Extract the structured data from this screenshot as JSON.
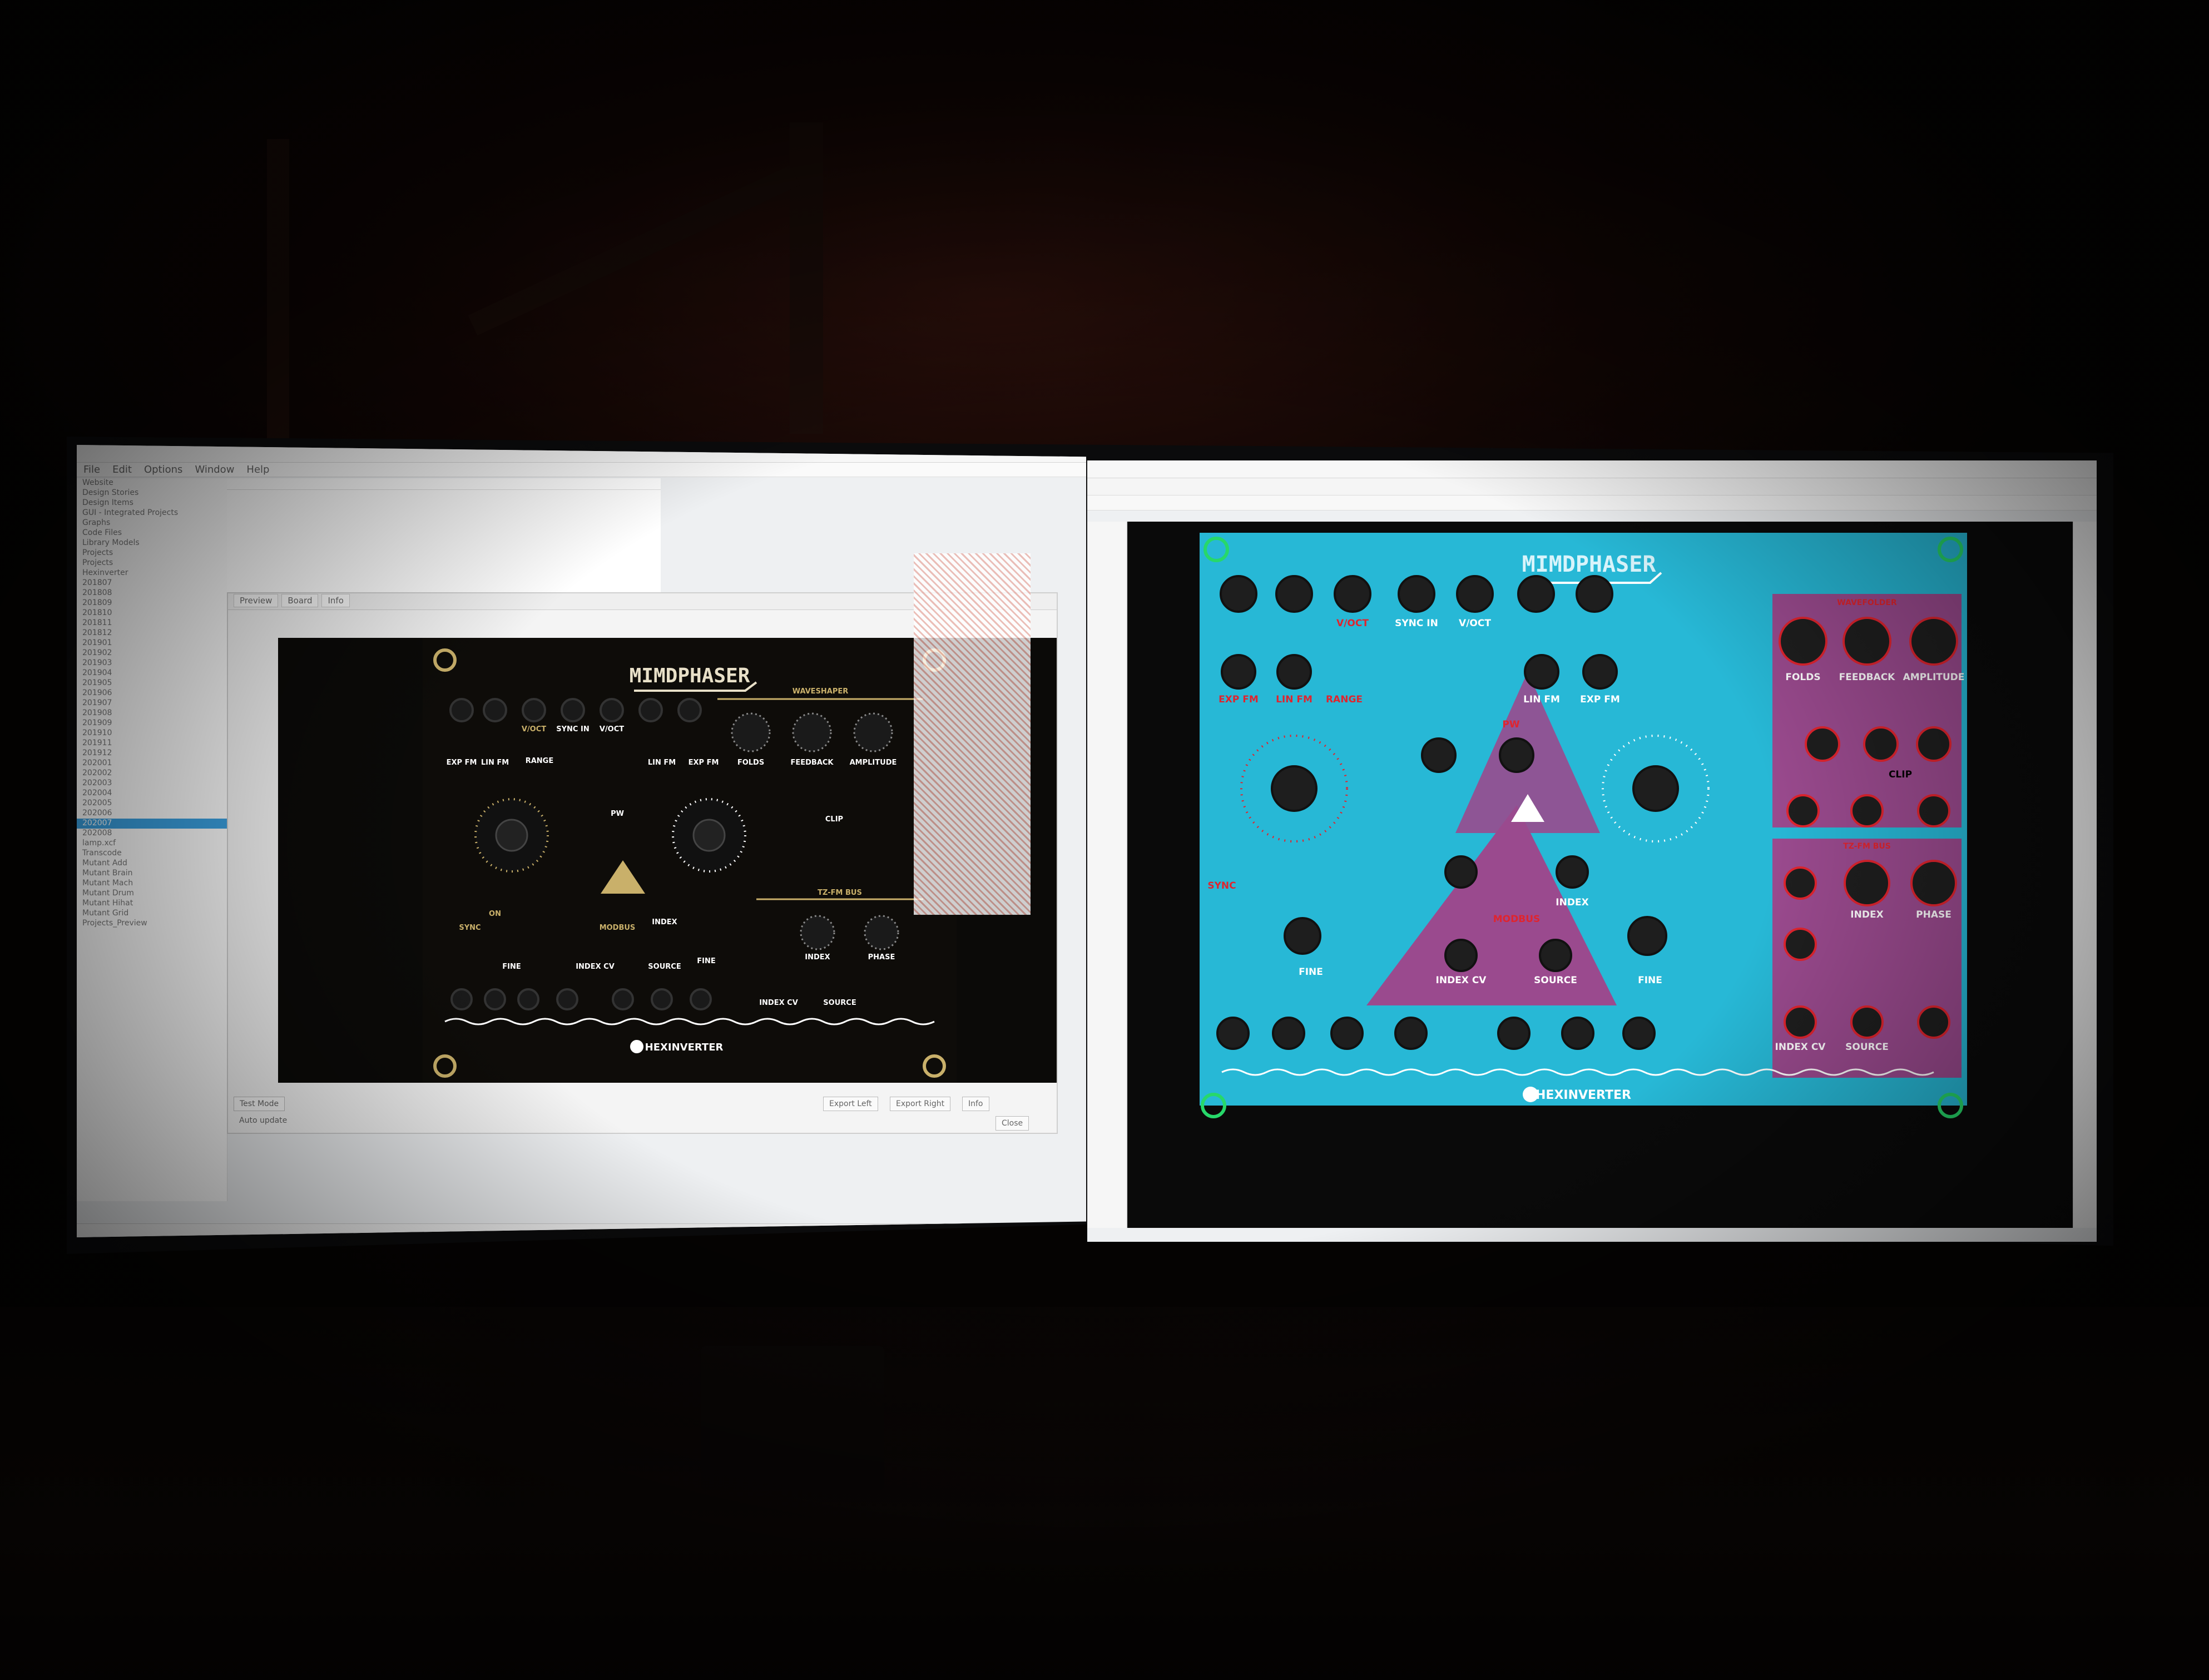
{
  "left_window": {
    "menu": [
      "File",
      "Edit",
      "Options",
      "Window",
      "Help"
    ],
    "tree_rows": [
      "Website",
      "Design Stories",
      "Design Items",
      "GUI - Integrated Projects",
      "Graphs",
      "Code Files",
      "Library Models",
      "Projects",
      "Projects",
      "Hexinverter",
      "201807",
      "201808",
      "201809",
      "201810",
      "201811",
      "201812",
      "201901",
      "201902",
      "201903",
      "201904",
      "201905",
      "201906",
      "201907",
      "201908",
      "201909",
      "201910",
      "201911",
      "201912",
      "202001",
      "202002",
      "202003",
      "202004",
      "202005",
      "202006",
      "202007",
      "202008",
      "lamp.xcf",
      "Transcode",
      "Mutant Add",
      "Mutant Brain",
      "Mutant Mach",
      "Mutant Drum",
      "Mutant Hihat",
      "Mutant Grid",
      "Projects_Preview"
    ],
    "selected_row": "202007",
    "dialog_tabs": [
      "Preview",
      "Board",
      "Info"
    ],
    "dialog_footer": {
      "left": "Test Mode",
      "checkbox": "Auto update",
      "btn1": "Export Left",
      "btn2": "Export Right",
      "btn3": "Info",
      "close": "Close"
    }
  },
  "gold_panel": {
    "title": "MIMDPHASER",
    "labels": {
      "exp_fm": "EXP FM",
      "lin_fm": "LIN FM",
      "range": "RANGE",
      "voct": "V/OCT",
      "sync_in": "SYNC IN",
      "voct2": "V/OCT",
      "lin_fm2": "LIN FM",
      "exp_fm2": "EXP FM",
      "wavefolder": "WAVESHAPER",
      "folds": "FOLDS",
      "feedback": "FEEDBACK",
      "amplitude": "AMPLITUDE",
      "clip": "CLIP",
      "pw": "PW",
      "on": "ON",
      "sync": "SYNC",
      "fine": "FINE",
      "fine2": "FINE",
      "index": "INDEX",
      "index_cv": "INDEX CV",
      "source": "SOURCE",
      "modbus": "MODBUS",
      "tzfm_bus": "TZ-FM BUS",
      "index2": "INDEX",
      "phase": "PHASE",
      "index_cv2": "INDEX CV",
      "source2": "SOURCE"
    },
    "footer": "HEXINVERTER"
  },
  "cyan_panel": {
    "title": "MIMDPHASER",
    "labels": {
      "voct": "V/OCT",
      "sync_in": "SYNC IN",
      "voct2": "V/OCT",
      "exp_fm": "EXP FM",
      "lin_fm": "LIN FM",
      "range": "RANGE",
      "lin_fm2": "LIN FM",
      "exp_fm2": "EXP FM",
      "wavefolder": "WAVEFOLDER",
      "folds": "FOLDS",
      "feedback": "FEEDBACK",
      "amplitude": "AMPLITUDE",
      "clip": "CLIP",
      "pw": "PW",
      "fine": "FINE",
      "fine2": "FINE",
      "modbus": "MODBUS",
      "index": "INDEX",
      "index_cv": "INDEX CV",
      "source": "SOURCE",
      "tzfm": "TZ-FM BUS",
      "index2": "INDEX",
      "phase": "PHASE",
      "index_cv2": "INDEX CV",
      "source2": "SOURCE",
      "sync": "SYNC"
    },
    "footer": "HEXINVERTER"
  },
  "colors": {
    "gold": "#c9b06a",
    "cyan": "#27b8d6",
    "magenta": "#9a4a8e",
    "red": "#e0242e",
    "green": "#27d86a"
  }
}
